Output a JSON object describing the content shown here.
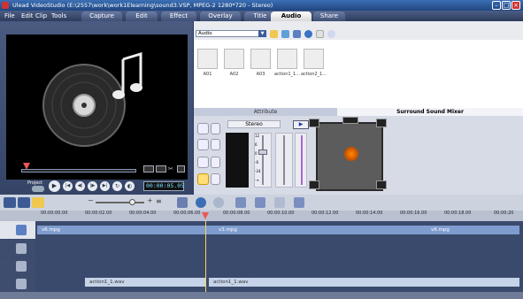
{
  "window": {
    "title": "Ulead VideoStudio (E:\\2557\\work\\work1Elearning\\sound3.VSP, MPEG-2 1280*720 - Stereo)"
  },
  "menu": [
    "File",
    "Edit",
    "Clip",
    "Tools"
  ],
  "tabs": [
    {
      "label": "Capture",
      "active": false
    },
    {
      "label": "Edit",
      "active": false
    },
    {
      "label": "Effect",
      "active": false
    },
    {
      "label": "Overlay",
      "active": false
    },
    {
      "label": "Title",
      "active": false
    },
    {
      "label": "Audio",
      "active": true
    },
    {
      "label": "Share",
      "active": false
    }
  ],
  "preview": {
    "mode_label": "Project",
    "timecode": "00:00:05.05"
  },
  "library": {
    "category": "Audio",
    "clips": [
      "A01",
      "A02",
      "A03",
      "action1_1...",
      "action2_1..."
    ]
  },
  "options": {
    "tabs": [
      "Attribute",
      "Surround Sound Mixer"
    ],
    "channel_mode": "Stereo",
    "fader_scale": [
      "12",
      "6",
      "0",
      "-6",
      "-24",
      "-∞"
    ]
  },
  "ruler": [
    "00:00:00.00",
    "00:00:02.00",
    "00:00:04.00",
    "00:00:06.00",
    "00:00:08.00",
    "00:00:10.00",
    "00:00:12.00",
    "00:00:14.00",
    "00:00:16.00",
    "00:00:18.00",
    "00:00:20"
  ],
  "timeline": {
    "video_clips": [
      "v6.mpg",
      "v3.mpg",
      "v6.mpg"
    ],
    "audio_clips": [
      "action1_1.wav",
      "action1_1.wav"
    ]
  },
  "colors": {
    "accent": "#3b6fb5",
    "clip_fill": "#7f9ccf",
    "audio_clip": "#c6d3e8"
  }
}
